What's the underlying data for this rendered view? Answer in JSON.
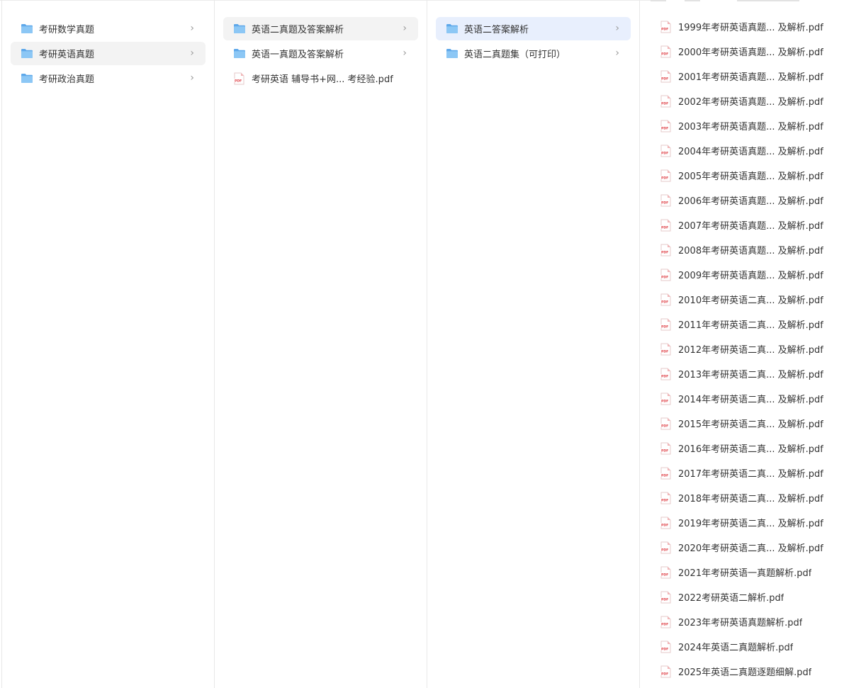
{
  "columns": [
    {
      "items": [
        {
          "type": "folder",
          "label": "考研数学真题",
          "state": ""
        },
        {
          "type": "folder",
          "label": "考研英语真题",
          "state": "hl"
        },
        {
          "type": "folder",
          "label": "考研政治真题",
          "state": ""
        }
      ]
    },
    {
      "items": [
        {
          "type": "folder",
          "label": "英语二真题及答案解析",
          "state": "hl"
        },
        {
          "type": "folder",
          "label": "英语一真题及答案解析",
          "state": ""
        },
        {
          "type": "pdf",
          "label": "考研英语 辅导书+网...  考经验.pdf",
          "state": ""
        }
      ]
    },
    {
      "items": [
        {
          "type": "folder",
          "label": "英语二答案解析",
          "state": "sel"
        },
        {
          "type": "folder",
          "label": "英语二真题集（可打印）",
          "state": ""
        }
      ]
    },
    {
      "items": [
        {
          "type": "pdf",
          "label": "1999年考研英语真题...  及解析.pdf",
          "state": ""
        },
        {
          "type": "pdf",
          "label": "2000年考研英语真题...  及解析.pdf",
          "state": ""
        },
        {
          "type": "pdf",
          "label": "2001年考研英语真题...  及解析.pdf",
          "state": ""
        },
        {
          "type": "pdf",
          "label": "2002年考研英语真题...  及解析.pdf",
          "state": ""
        },
        {
          "type": "pdf",
          "label": "2003年考研英语真题...  及解析.pdf",
          "state": ""
        },
        {
          "type": "pdf",
          "label": "2004年考研英语真题...  及解析.pdf",
          "state": ""
        },
        {
          "type": "pdf",
          "label": "2005年考研英语真题...  及解析.pdf",
          "state": ""
        },
        {
          "type": "pdf",
          "label": "2006年考研英语真题...  及解析.pdf",
          "state": ""
        },
        {
          "type": "pdf",
          "label": "2007年考研英语真题...  及解析.pdf",
          "state": ""
        },
        {
          "type": "pdf",
          "label": "2008年考研英语真题...  及解析.pdf",
          "state": ""
        },
        {
          "type": "pdf",
          "label": "2009年考研英语真题...  及解析.pdf",
          "state": ""
        },
        {
          "type": "pdf",
          "label": "2010年考研英语二真...  及解析.pdf",
          "state": ""
        },
        {
          "type": "pdf",
          "label": "2011年考研英语二真...  及解析.pdf",
          "state": ""
        },
        {
          "type": "pdf",
          "label": "2012年考研英语二真...  及解析.pdf",
          "state": ""
        },
        {
          "type": "pdf",
          "label": "2013年考研英语二真...  及解析.pdf",
          "state": ""
        },
        {
          "type": "pdf",
          "label": "2014年考研英语二真...  及解析.pdf",
          "state": ""
        },
        {
          "type": "pdf",
          "label": "2015年考研英语二真...  及解析.pdf",
          "state": ""
        },
        {
          "type": "pdf",
          "label": "2016年考研英语二真...  及解析.pdf",
          "state": ""
        },
        {
          "type": "pdf",
          "label": "2017年考研英语二真...  及解析.pdf",
          "state": ""
        },
        {
          "type": "pdf",
          "label": "2018年考研英语二真...  及解析.pdf",
          "state": ""
        },
        {
          "type": "pdf",
          "label": "2019年考研英语二真...  及解析.pdf",
          "state": ""
        },
        {
          "type": "pdf",
          "label": "2020年考研英语二真...  及解析.pdf",
          "state": ""
        },
        {
          "type": "pdf",
          "label": "2021年考研英语一真题解析.pdf",
          "state": ""
        },
        {
          "type": "pdf",
          "label": "2022考研英语二解析.pdf",
          "state": ""
        },
        {
          "type": "pdf",
          "label": "2023年考研英语真题解析.pdf",
          "state": ""
        },
        {
          "type": "pdf",
          "label": "2024年英语二真题解析.pdf",
          "state": ""
        },
        {
          "type": "pdf",
          "label": "2025年英语二真题逐题细解.pdf",
          "state": ""
        }
      ]
    }
  ],
  "icons": {
    "folder": "folder-icon",
    "pdf": "pdf-file-icon",
    "chevron": "chevron-right-icon"
  },
  "colors": {
    "hover": "#f3f3f3",
    "selected": "#e8effd",
    "folder": "#6fb3ee",
    "pdf": "#e0454b"
  }
}
